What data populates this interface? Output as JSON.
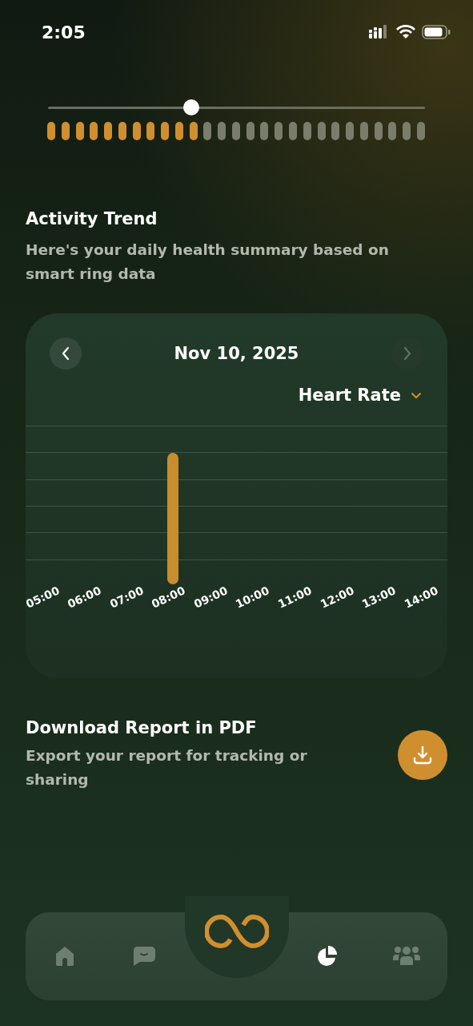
{
  "status_bar": {
    "time": "2:05"
  },
  "quality_slider": {
    "level": 0.38
  },
  "quality_meter": {
    "level": 0.41
  },
  "activity": {
    "title": "Activity Trend",
    "subtitle": "Here's your daily health summary based on smart ring data"
  },
  "chart_card": {
    "date": "Nov 10, 2025",
    "prev_enabled": true,
    "next_enabled": false,
    "metric": "Heart Rate",
    "x_labels": [
      {
        "label": "05:00",
        "has_bar": false
      },
      {
        "label": "06:00",
        "has_bar": false
      },
      {
        "label": "07:00",
        "has_bar": false
      },
      {
        "label": "08:00",
        "has_bar": true
      },
      {
        "label": "09:00",
        "has_bar": false
      },
      {
        "label": "10:00",
        "has_bar": false
      },
      {
        "label": "11:00",
        "has_bar": false
      },
      {
        "label": "12:00",
        "has_bar": false
      },
      {
        "label": "13:00",
        "has_bar": false
      },
      {
        "label": "14:00",
        "has_bar": false
      }
    ]
  },
  "download": {
    "title": "Download Report in PDF",
    "subtitle": "Export your report for tracking or sharing"
  },
  "nav": [
    {
      "kind": "home",
      "selected": false
    },
    {
      "kind": "chat",
      "selected": false
    },
    {
      "kind": "chart",
      "selected": true
    },
    {
      "kind": "people",
      "selected": false
    }
  ]
}
